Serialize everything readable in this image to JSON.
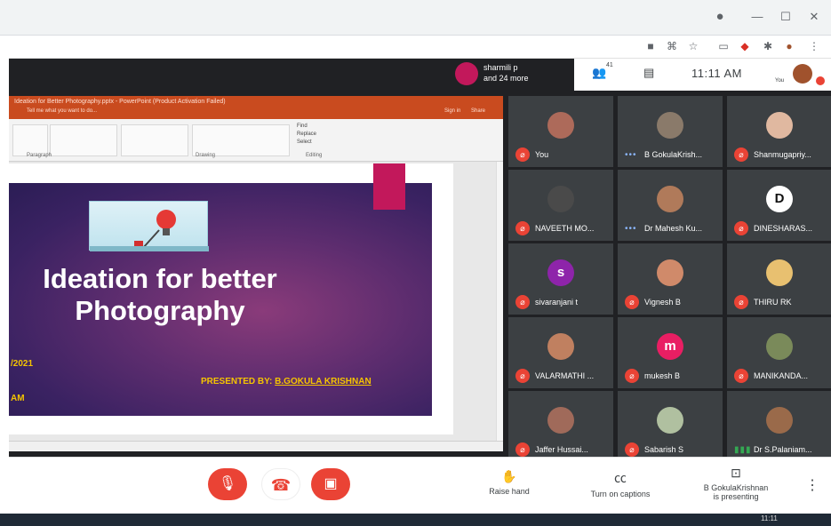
{
  "window": {
    "record_icon": "circle-icon",
    "minimize": "—",
    "maximize": "☐",
    "close": "✕"
  },
  "browser_toolbar": {
    "icons": [
      "camera-icon",
      "grid-icon",
      "star-icon",
      "tab-icon",
      "shield-icon",
      "puzzle-icon",
      "profile-icon",
      "menu-icon"
    ]
  },
  "meet": {
    "participants_summary": {
      "line1": "sharmili p",
      "line2": "and 24 more"
    },
    "people_count": "41",
    "time": "11:11 AM",
    "self_label": "You"
  },
  "powerpoint": {
    "window_title": "Ideation for Better Photography.pptx - PowerPoint (Product Activation Failed)",
    "tell_me": "Tell me what you want to do...",
    "sign_in": "Sign in",
    "share": "Share",
    "ribbon_groups": [
      "Paragraph",
      "Drawing",
      "Editing"
    ],
    "editing_items": [
      "Find",
      "Replace",
      "Select"
    ],
    "slide": {
      "title_line1": "Ideation for better",
      "title_line2": "Photography",
      "date_fragment": "/2021",
      "time_fragment": "AM",
      "presented_prefix": "PRESENTED BY: ",
      "presenter_name": "B.GOKULA KRISHNAN"
    }
  },
  "tiles": [
    {
      "name": "You",
      "mic": "off",
      "avatar": "",
      "color": "#ad6a5a"
    },
    {
      "name": "B GokulaKrish...",
      "mic": "on",
      "avatar": "",
      "color": "#8a7a6a"
    },
    {
      "name": "Shanmugapriy...",
      "mic": "off",
      "avatar": "",
      "color": "#e0b8a0"
    },
    {
      "name": "NAVEETH MO...",
      "mic": "off",
      "avatar": "",
      "color": "#4a4a4a"
    },
    {
      "name": "Dr Mahesh Ku...",
      "mic": "on",
      "avatar": "",
      "color": "#b07a5a"
    },
    {
      "name": "DINESHARAS...",
      "mic": "off",
      "avatar": "D",
      "color": "#ffffff"
    },
    {
      "name": "sivaranjani t",
      "mic": "off",
      "avatar": "s",
      "color": "#8e24aa"
    },
    {
      "name": "Vignesh B",
      "mic": "off",
      "avatar": "",
      "color": "#d08a6a"
    },
    {
      "name": "THIRU RK",
      "mic": "off",
      "avatar": "",
      "color": "#e8c070"
    },
    {
      "name": "VALARMATHI ...",
      "mic": "off",
      "avatar": "",
      "color": "#c08060"
    },
    {
      "name": "mukesh B",
      "mic": "off",
      "avatar": "m",
      "color": "#e91e63"
    },
    {
      "name": "MANIKANDA...",
      "mic": "off",
      "avatar": "",
      "color": "#7a8a5a"
    },
    {
      "name": "Jaffer Hussai...",
      "mic": "off",
      "avatar": "",
      "color": "#a06a5a"
    },
    {
      "name": "Sabarish S",
      "mic": "off",
      "avatar": "",
      "color": "#b0c0a0"
    },
    {
      "name": "Dr S.Palaniam...",
      "mic": "speaking",
      "avatar": "",
      "color": "#9a6a4a"
    }
  ],
  "controls": {
    "raise_hand": "Raise hand",
    "captions": "Turn on captions",
    "presenting_line1": "B GokulaKrishnan",
    "presenting_line2": "is presenting"
  },
  "taskbar": {
    "time": "11:11"
  }
}
